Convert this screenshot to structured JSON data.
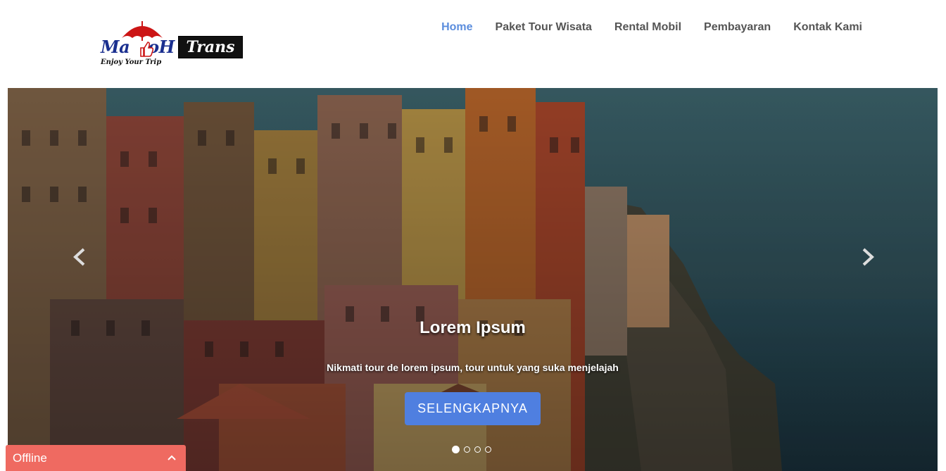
{
  "brand": {
    "logo_left": "Ma",
    "logo_mid": "oH",
    "logo_right": "Trans",
    "tagline": "Enjoy Your Trip"
  },
  "nav": {
    "items": [
      {
        "label": "Home",
        "active": true
      },
      {
        "label": "Paket Tour Wisata",
        "active": false
      },
      {
        "label": "Rental Mobil",
        "active": false
      },
      {
        "label": "Pembayaran",
        "active": false
      },
      {
        "label": "Kontak Kami",
        "active": false
      }
    ]
  },
  "hero": {
    "title": "Lorem Ipsum",
    "subtitle": "Nikmati tour de lorem ipsum, tour untuk yang suka menjelajah",
    "cta_label": "SELENGKAPNYA",
    "slide_count": 4,
    "active_slide": 1,
    "prev_icon": "chevron-left-icon",
    "next_icon": "chevron-right-icon"
  },
  "chat": {
    "status_label": "Offline",
    "toggle_icon": "chevron-up-icon"
  },
  "colors": {
    "nav_active": "#5b8ddd",
    "nav_text": "#555555",
    "cta_bg": "#4f7fe0",
    "chat_bg": "#ef6a61",
    "logo_umbrella": "#cc1515",
    "logo_text": "#1a2f8f"
  }
}
